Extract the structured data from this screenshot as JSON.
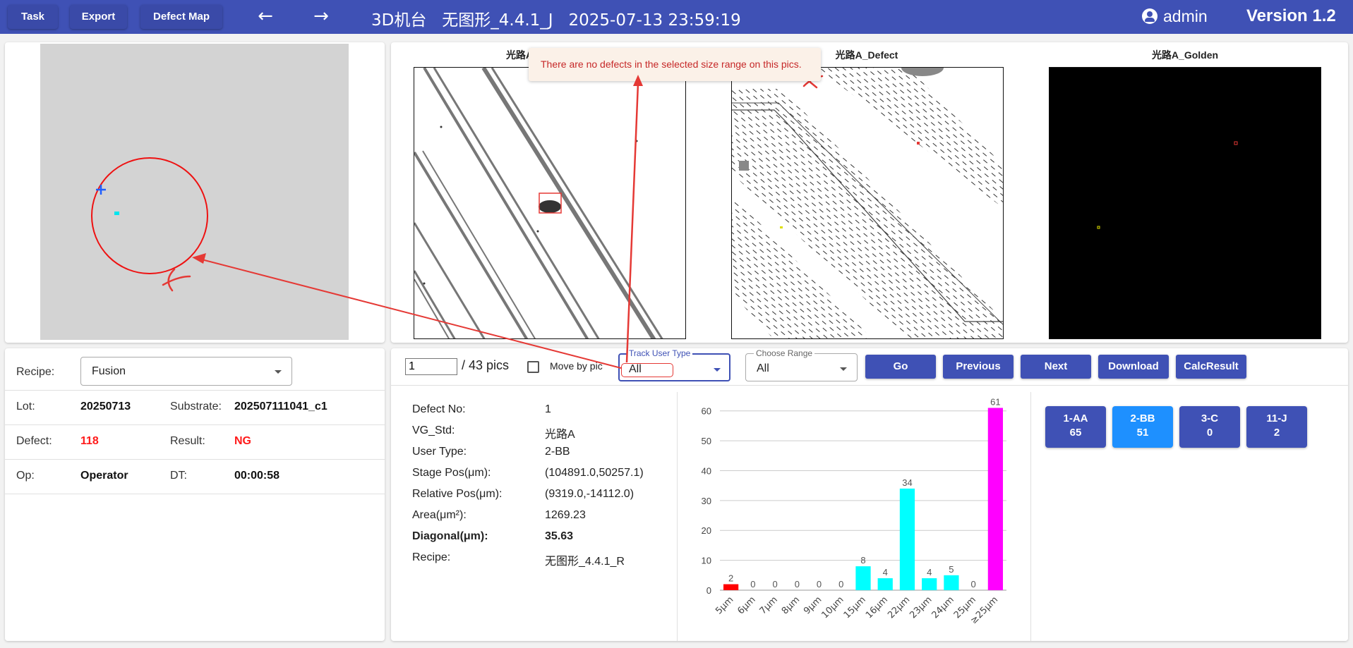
{
  "toolbar": {
    "task_label": "Task",
    "export_label": "Export",
    "defect_map_label": "Defect Map",
    "back_icon": "arrow-left-icon",
    "forward_icon": "arrow-right-icon",
    "title": "3D机台   无图形_4.4.1_J   2025-07-13 23:59:19",
    "user_icon": "account-circle-icon",
    "user_name": "admin",
    "version": "Version 1.2",
    "bar_color": "#3f51b5"
  },
  "images": {
    "titles": [
      "光路A",
      "光路A_Defect",
      "光路A_Golden"
    ]
  },
  "tooltip": {
    "message": "There are no defects in the selected size range on this pics."
  },
  "details": {
    "recipe_label": "Recipe:",
    "recipe_value": "Fusion",
    "lot_label": "Lot:",
    "lot_value": "20250713",
    "substrate_label": "Substrate:",
    "substrate_value": "202507111041_c1",
    "defect_label": "Defect:",
    "defect_value": "118",
    "result_label": "Result:",
    "result_value": "NG",
    "op_label": "Op:",
    "op_value": "Operator",
    "dt_label": "DT:",
    "dt_value": "00:00:58",
    "alert_color": "#ff1a1a"
  },
  "controls": {
    "page_value": "1",
    "page_total": "/ 43 pics",
    "move_by_pic_label": "Move by pic",
    "move_by_pic_checked": false,
    "track_user_type_label": "Track User Type",
    "track_user_type_value": "All",
    "choose_range_label": "Choose Range",
    "choose_range_value": "All",
    "go_label": "Go",
    "previous_label": "Previous",
    "next_label": "Next",
    "download_label": "Download",
    "calc_result_label": "CalcResult"
  },
  "defect_info": [
    {
      "label": "Defect No:",
      "value": "1",
      "bold": false
    },
    {
      "label": "VG_Std:",
      "value": "光路A",
      "bold": false
    },
    {
      "label": "User Type:",
      "value": "2-BB",
      "bold": false
    },
    {
      "label": "Stage Pos(μm):",
      "value": "(104891.0,50257.1)",
      "bold": false
    },
    {
      "label": "Relative Pos(μm):",
      "value": "(9319.0,-14112.0)",
      "bold": false
    },
    {
      "label": "Area(μm²):",
      "value": "1269.23",
      "bold": false
    },
    {
      "label": "Diagonal(μm):",
      "value": "35.63",
      "bold": true
    },
    {
      "label": "Recipe:",
      "value": "无图形_4.4.1_R",
      "bold": false
    }
  ],
  "user_types": [
    {
      "name": "1-AA",
      "count": "65",
      "color": "#3f51b5"
    },
    {
      "name": "2-BB",
      "count": "51",
      "color": "#1e90ff"
    },
    {
      "name": "3-C",
      "count": "0",
      "color": "#3f51b5"
    },
    {
      "name": "11-J",
      "count": "2",
      "color": "#3f51b5"
    }
  ],
  "chart_data": {
    "type": "bar",
    "categories": [
      "5μm",
      "6μm",
      "7μm",
      "8μm",
      "9μm",
      "10μm",
      "15μm",
      "16μm",
      "22μm",
      "23μm",
      "24μm",
      "25μm",
      "≥25μm"
    ],
    "values": [
      2,
      0,
      0,
      0,
      0,
      0,
      8,
      4,
      34,
      4,
      5,
      0,
      61
    ],
    "colors": [
      "#ff0000",
      "#00ffff",
      "#00ffff",
      "#00ffff",
      "#00ffff",
      "#00ffff",
      "#00ffff",
      "#00ffff",
      "#00ffff",
      "#00ffff",
      "#00ffff",
      "#00ffff",
      "#ff00ff"
    ],
    "yticks": [
      0,
      10,
      20,
      30,
      40,
      50,
      60
    ],
    "ylim": [
      0,
      63
    ],
    "grid": true
  }
}
